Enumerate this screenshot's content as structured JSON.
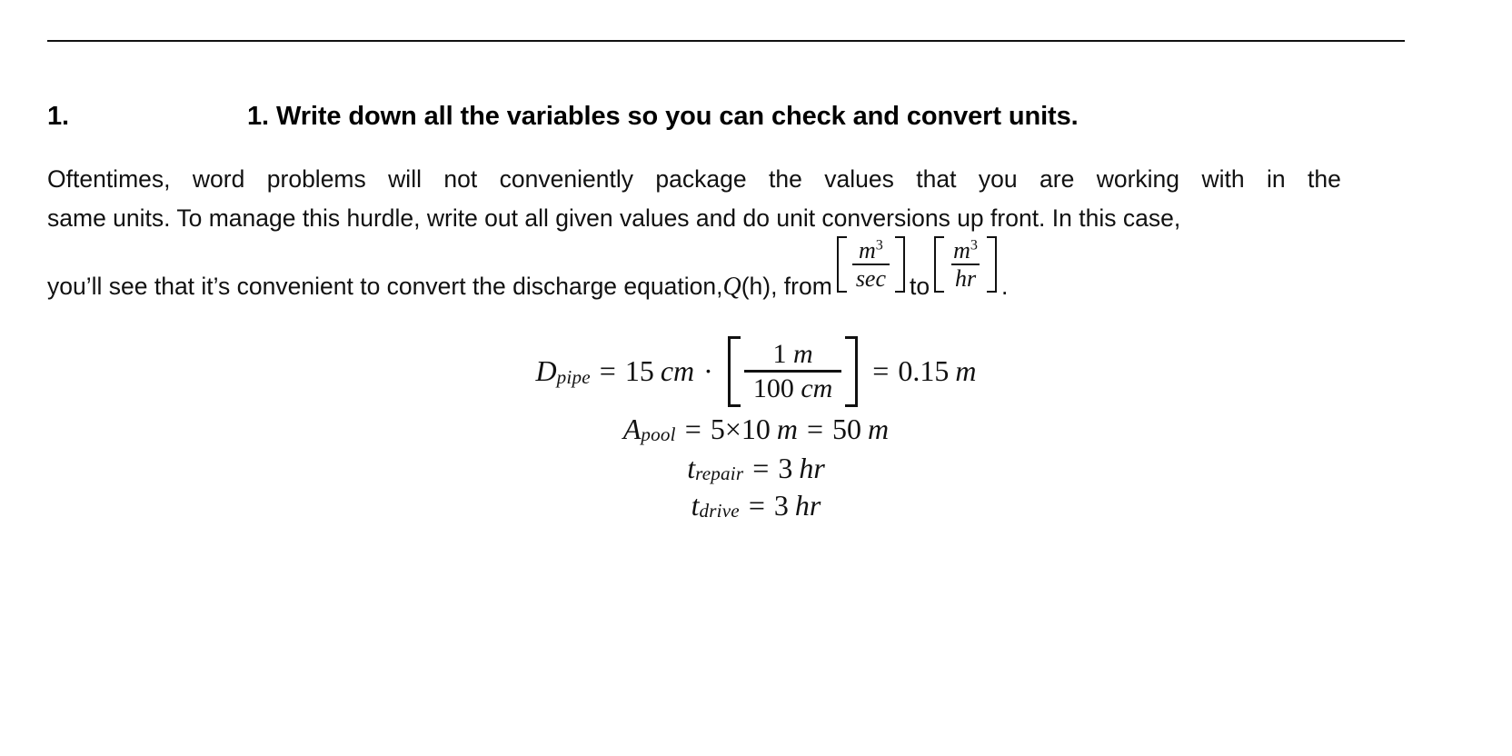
{
  "document": {
    "heading": {
      "list_number": "1.",
      "text": "1. Write down all the variables so you can check and convert units."
    },
    "paragraph": {
      "line1": [
        "Oftentimes,",
        "word",
        "problems",
        "will",
        "not",
        "conveniently",
        "package",
        "the",
        "values",
        "that",
        "you",
        "are",
        "working",
        "with",
        "in",
        "the"
      ],
      "line2": "same units. To manage this hurdle, write out all given values and do unit conversions up front. In this case,",
      "line3_pre": "you’ll see that it’s convenient to convert the discharge equation, ",
      "line3_Q": "Q",
      "line3_Qargs": "(h)",
      "line3_mid": ", from ",
      "line3_to": " to ",
      "line3_end": ".",
      "frac1": {
        "numerator": "m",
        "numerator_sup": "3",
        "denominator": "sec"
      },
      "frac2": {
        "numerator": "m",
        "numerator_sup": "3",
        "denominator": "hr"
      }
    },
    "equations": {
      "eq1": {
        "symbol": "D",
        "subscript": "pipe",
        "equals": "=",
        "value": "15",
        "unit": "cm",
        "dot": "·",
        "frac_num_value": "1",
        "frac_num_unit": "m",
        "frac_den_value": "100",
        "frac_den_unit": "cm",
        "equals2": "=",
        "result": "0.15",
        "result_unit": "m"
      },
      "eq2": {
        "symbol": "A",
        "subscript": "pool",
        "equals": "=",
        "value": "5×10",
        "unit": "m",
        "equals2": "=",
        "result": "50",
        "result_unit": "m"
      },
      "eq3": {
        "symbol": "t",
        "subscript": "repair",
        "equals": "=",
        "value": "3",
        "unit": "hr"
      },
      "eq4": {
        "symbol": "t",
        "subscript": "drive",
        "equals": "=",
        "value": "3",
        "unit": "hr"
      }
    }
  },
  "colors": {
    "text": "#111111",
    "background": "#ffffff",
    "rule": "#111111"
  }
}
